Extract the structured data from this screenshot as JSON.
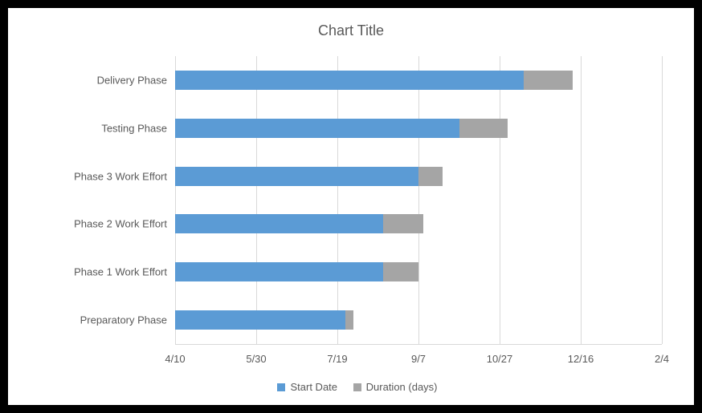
{
  "chart_data": {
    "type": "bar",
    "orientation": "horizontal-stacked",
    "title": "Chart Title",
    "x_axis": {
      "type": "date",
      "min": "4/10",
      "max": "2/4",
      "ticks": [
        "4/10",
        "5/30",
        "7/19",
        "9/7",
        "10/27",
        "12/16",
        "2/4"
      ],
      "tick_values_days_from_min": [
        0,
        50,
        100,
        150,
        200,
        250,
        300
      ]
    },
    "categories": [
      "Delivery Phase",
      "Testing Phase",
      "Phase 3 Work Effort",
      "Phase 2 Work Effort",
      "Phase 1 Work Effort",
      "Preparatory Phase"
    ],
    "series": [
      {
        "name": "Start Date",
        "color": "#5b9bd5",
        "values_days_from_min": [
          215,
          175,
          150,
          128,
          128,
          105
        ]
      },
      {
        "name": "Duration (days)",
        "color": "#a5a5a5",
        "values_days": [
          30,
          30,
          15,
          25,
          22,
          5
        ]
      }
    ],
    "legend": [
      "Start Date",
      "Duration (days)"
    ]
  }
}
